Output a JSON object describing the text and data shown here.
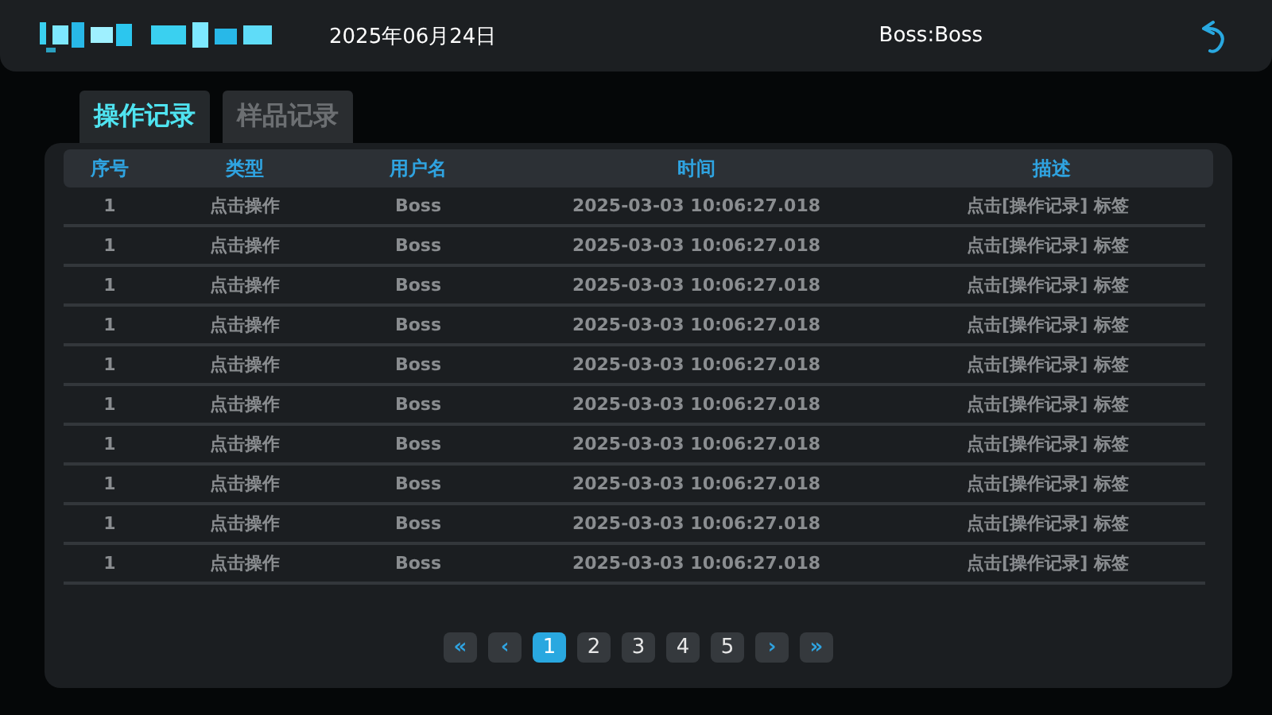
{
  "header": {
    "date": "2025年06月24日",
    "user": "Boss:Boss"
  },
  "tabs": [
    {
      "label": "操作记录",
      "selected": true
    },
    {
      "label": "样品记录",
      "selected": false
    }
  ],
  "table": {
    "columns": [
      "序号",
      "类型",
      "用户名",
      "时间",
      "描述"
    ],
    "rows": [
      [
        "1",
        "点击操作",
        "Boss",
        "2025-03-03 10:06:27.018",
        "点击[操作记录] 标签"
      ],
      [
        "1",
        "点击操作",
        "Boss",
        "2025-03-03 10:06:27.018",
        "点击[操作记录] 标签"
      ],
      [
        "1",
        "点击操作",
        "Boss",
        "2025-03-03 10:06:27.018",
        "点击[操作记录] 标签"
      ],
      [
        "1",
        "点击操作",
        "Boss",
        "2025-03-03 10:06:27.018",
        "点击[操作记录] 标签"
      ],
      [
        "1",
        "点击操作",
        "Boss",
        "2025-03-03 10:06:27.018",
        "点击[操作记录] 标签"
      ],
      [
        "1",
        "点击操作",
        "Boss",
        "2025-03-03 10:06:27.018",
        "点击[操作记录] 标签"
      ],
      [
        "1",
        "点击操作",
        "Boss",
        "2025-03-03 10:06:27.018",
        "点击[操作记录] 标签"
      ],
      [
        "1",
        "点击操作",
        "Boss",
        "2025-03-03 10:06:27.018",
        "点击[操作记录] 标签"
      ],
      [
        "1",
        "点击操作",
        "Boss",
        "2025-03-03 10:06:27.018",
        "点击[操作记录] 标签"
      ],
      [
        "1",
        "点击操作",
        "Boss",
        "2025-03-03 10:06:27.018",
        "点击[操作记录] 标签"
      ]
    ]
  },
  "pagination": {
    "first": "«",
    "prev": "‹",
    "pages": [
      {
        "label": "1",
        "selected": true
      },
      {
        "label": "2",
        "selected": false
      },
      {
        "label": "3",
        "selected": false
      },
      {
        "label": "4",
        "selected": false
      },
      {
        "label": "5",
        "selected": false
      }
    ],
    "next": "›",
    "last": "»"
  }
}
